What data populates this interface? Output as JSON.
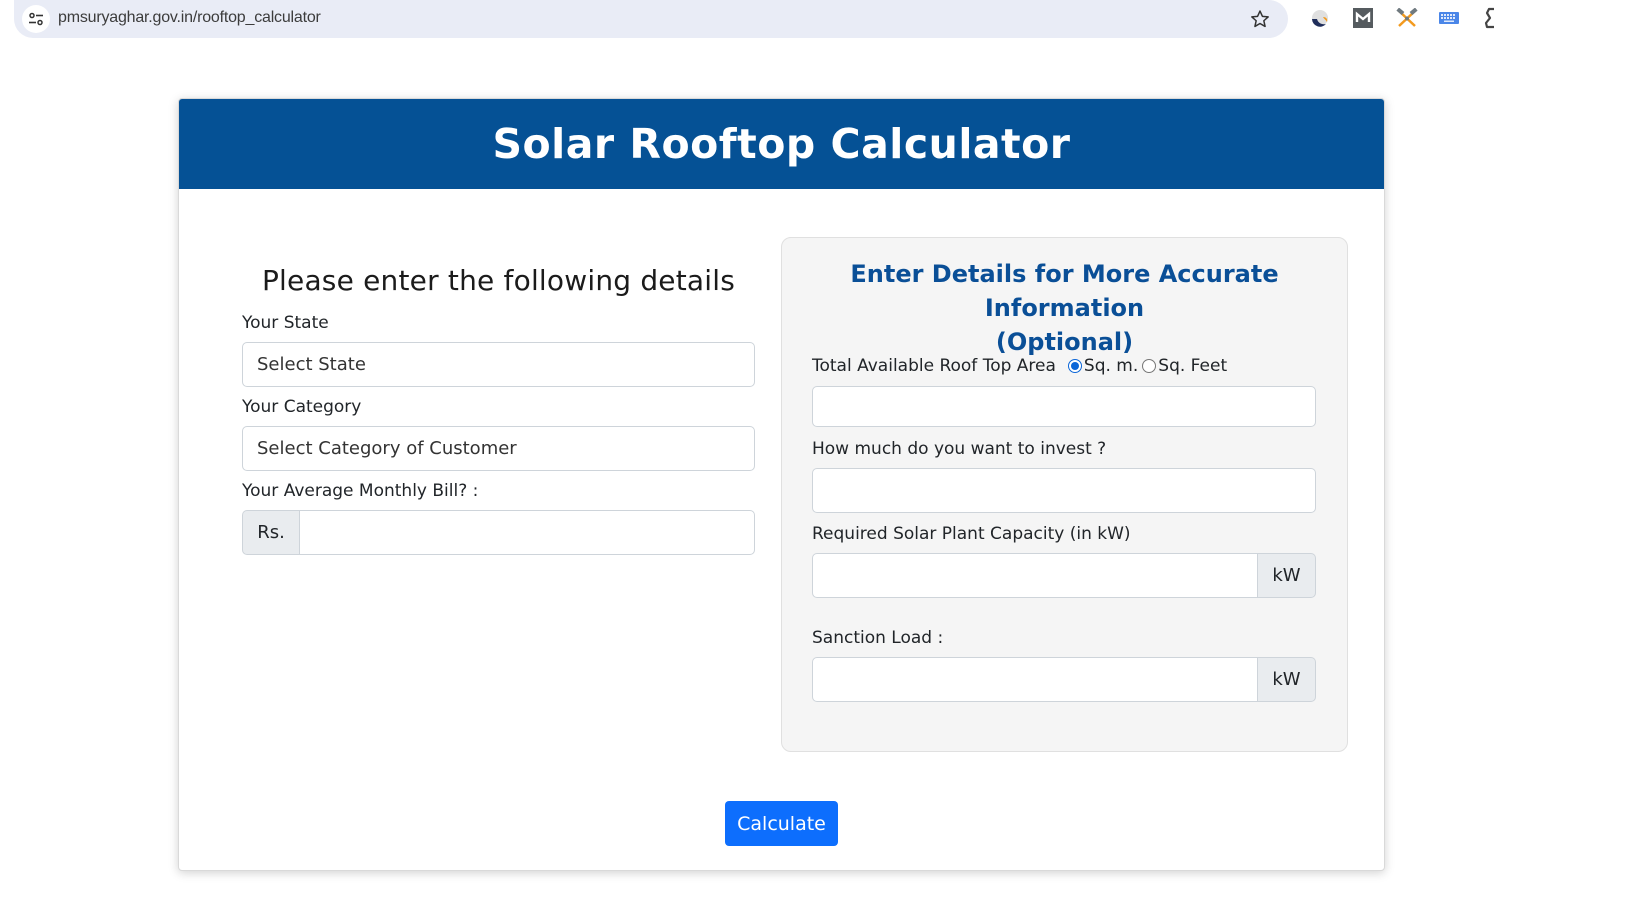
{
  "browser": {
    "url": "pmsuryaghar.gov.in/rooftop_calculator",
    "extensions": [
      "swirl-extension-icon",
      "m-extension-icon",
      "crossed-hammers-extension-icon",
      "keyboard-extension-icon",
      "sigma-extension-icon"
    ]
  },
  "page": {
    "title": "Solar Rooftop Calculator"
  },
  "left": {
    "heading": "Please enter the following details",
    "state_label": "Your State",
    "state_value": "Select State",
    "category_label": "Your Category",
    "category_value": "Select Category of Customer",
    "bill_label": "Your Average Monthly Bill? :",
    "bill_addon": "Rs.",
    "bill_value": ""
  },
  "optional": {
    "title_line1": "Enter Details for More Accurate Information",
    "title_line2": "(Optional)",
    "roof_label": "Total Available Roof Top Area",
    "unit_options": [
      {
        "label": "Sq. m.",
        "selected": true
      },
      {
        "label": "Sq. Feet",
        "selected": false
      }
    ],
    "roof_value": "",
    "invest_label": "How much do you want to invest ?",
    "invest_value": "",
    "capacity_label": "Required Solar Plant Capacity (in kW)",
    "capacity_addon": "kW",
    "capacity_value": "",
    "sanction_label": "Sanction Load :",
    "sanction_addon": "kW",
    "sanction_value": ""
  },
  "actions": {
    "calculate_label": "Calculate"
  },
  "colors": {
    "header_bg": "#055195",
    "optional_title": "#0a4f97",
    "primary_button": "#0d6efd"
  }
}
